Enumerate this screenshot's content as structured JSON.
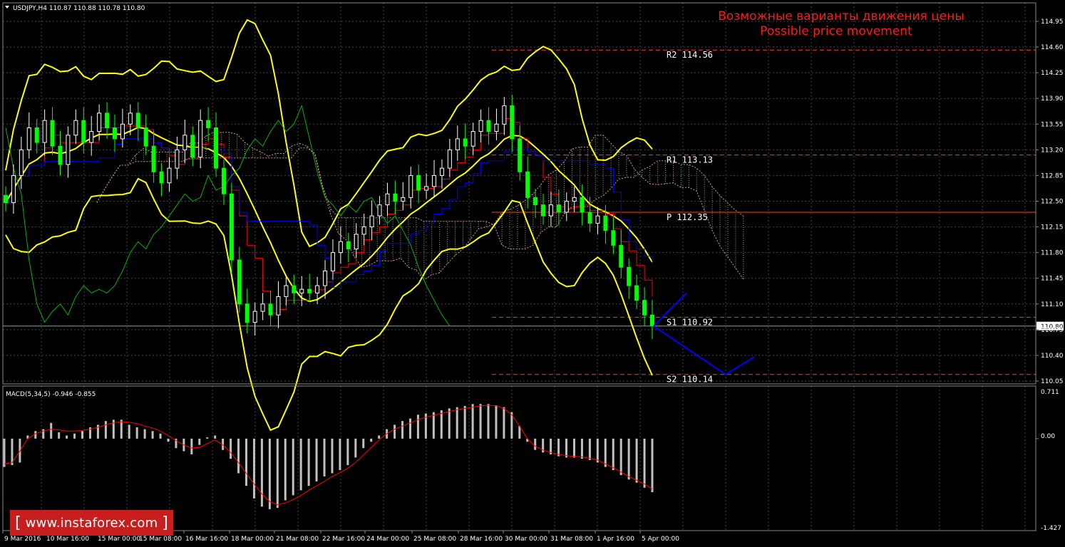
{
  "header": {
    "symbol_line": "USDJPY,H4  110.87 110.88 110.78 110.80"
  },
  "annotation": {
    "line1": "Возможные варианты движения цены",
    "line2": "Possible price movement"
  },
  "macd": {
    "label": "MACD(5,34,5) -0.946 -0.855",
    "axis": {
      "top": "0.711",
      "zero": "0.00",
      "bottom": "-1.427",
      "min": -1.427,
      "max": 0.711
    }
  },
  "watermark": {
    "bracket_left": "[",
    "text": "www.instaforex.com",
    "bracket_right": "]"
  },
  "colors": {
    "background": "#000000",
    "grid": "#3a4a3a",
    "bollinger": "#ffff00",
    "tenkan": "#ff0000",
    "kijun": "#0000ff",
    "chikou": "#00b400",
    "cloud": "#c8a080",
    "levels": "#ff3b1f",
    "forecast": "#0000ff",
    "candle_bull": "#ffffff",
    "candle_bear": "#00ff00",
    "signal": "#ff0000",
    "histogram": "#c0c0c0"
  },
  "chart_data": {
    "type": "line",
    "instrument": "USDJPY",
    "timeframe": "H4",
    "ohlc_current": {
      "open": 110.87,
      "high": 110.88,
      "low": 110.78,
      "close": 110.8
    },
    "ylim": [
      110.05,
      114.95
    ],
    "y_ticks": [
      "114.95",
      "114.60",
      "114.25",
      "113.90",
      "113.55",
      "113.20",
      "112.85",
      "112.50",
      "112.15",
      "111.80",
      "111.45",
      "111.10",
      "110.75",
      "110.40",
      "110.05"
    ],
    "current_price_label": "110.80",
    "x_ticks": [
      "9 Mar 2016",
      "10 Mar 16:00",
      "15 Mar 00:00",
      "15 Mar 08:00",
      "16 Mar 16:00",
      "18 Mar 00:00",
      "21 Mar 08:00",
      "22 Mar 16:00",
      "24 Mar 00:00",
      "25 Mar 08:00",
      "28 Mar 16:00",
      "30 Mar 00:00",
      "31 Mar 08:00",
      "1 Apr 16:00",
      "5 Apr 00:00"
    ],
    "pivot_levels": [
      {
        "name": "R2",
        "label": "R2 114.56",
        "value": 114.56
      },
      {
        "name": "R1",
        "label": "R1 113.13",
        "value": 113.13
      },
      {
        "name": "P",
        "label": "P 112.35",
        "value": 112.35
      },
      {
        "name": "S1",
        "label": "S1 110.92",
        "value": 110.92
      },
      {
        "name": "S2",
        "label": "S2 110.14",
        "value": 110.14
      }
    ],
    "close_series": [
      112.48,
      112.85,
      113.2,
      113.5,
      113.3,
      113.6,
      113.25,
      113.0,
      113.4,
      113.6,
      113.3,
      113.45,
      113.7,
      113.5,
      113.35,
      113.55,
      113.7,
      113.5,
      113.25,
      112.9,
      112.75,
      112.95,
      113.2,
      113.4,
      113.1,
      113.6,
      113.5,
      112.95,
      112.6,
      111.7,
      111.1,
      110.85,
      111.0,
      111.1,
      110.95,
      111.2,
      111.35,
      111.25,
      111.3,
      111.25,
      111.35,
      111.55,
      111.8,
      111.95,
      111.85,
      112.05,
      112.15,
      112.3,
      112.45,
      112.6,
      112.5,
      112.55,
      112.85,
      112.65,
      112.7,
      112.85,
      112.95,
      113.2,
      113.35,
      113.25,
      113.45,
      113.6,
      113.45,
      113.55,
      113.8,
      113.35,
      112.9,
      112.55,
      112.45,
      112.3,
      112.45,
      112.35,
      112.5,
      112.55,
      112.35,
      112.2,
      112.3,
      112.1,
      111.9,
      111.6,
      111.35,
      111.15,
      110.95,
      110.8
    ],
    "forecast_down": [
      [
        110.8,
        0
      ],
      [
        110.14,
        1
      ],
      [
        110.38,
        2
      ]
    ],
    "forecast_up": [
      [
        110.8,
        0
      ],
      [
        111.25,
        1
      ]
    ],
    "macd_histogram": [
      -0.45,
      -0.42,
      -0.38,
      0.05,
      0.12,
      0.15,
      0.25,
      0.1,
      0.05,
      0.08,
      0.12,
      0.18,
      0.22,
      0.28,
      0.3,
      0.3,
      0.22,
      0.18,
      0.15,
      0.12,
      0.08,
      -0.05,
      -0.15,
      -0.2,
      -0.25,
      -0.1,
      0.02,
      0.05,
      -0.18,
      -0.32,
      -0.55,
      -0.75,
      -0.95,
      -1.08,
      -1.12,
      -1.1,
      -0.98,
      -0.9,
      -0.82,
      -0.75,
      -0.68,
      -0.6,
      -0.55,
      -0.5,
      -0.42,
      -0.3,
      -0.15,
      -0.05,
      0.05,
      0.15,
      0.22,
      0.28,
      0.32,
      0.38,
      0.4,
      0.42,
      0.45,
      0.48,
      0.5,
      0.52,
      0.55,
      0.55,
      0.55,
      0.53,
      0.5,
      0.42,
      0.2,
      -0.05,
      -0.18,
      -0.22,
      -0.25,
      -0.28,
      -0.3,
      -0.3,
      -0.32,
      -0.34,
      -0.38,
      -0.45,
      -0.5,
      -0.58,
      -0.65,
      -0.7,
      -0.78,
      -0.85
    ],
    "macd_signal": [
      -0.4,
      -0.38,
      -0.2,
      0.0,
      0.08,
      0.12,
      0.15,
      0.14,
      0.12,
      0.12,
      0.13,
      0.15,
      0.18,
      0.22,
      0.25,
      0.27,
      0.26,
      0.24,
      0.2,
      0.17,
      0.12,
      0.05,
      -0.03,
      -0.1,
      -0.15,
      -0.14,
      -0.08,
      -0.02,
      -0.1,
      -0.22,
      -0.38,
      -0.55,
      -0.72,
      -0.88,
      -1.0,
      -1.05,
      -1.02,
      -0.97,
      -0.9,
      -0.82,
      -0.75,
      -0.68,
      -0.6,
      -0.54,
      -0.47,
      -0.38,
      -0.26,
      -0.14,
      -0.02,
      0.08,
      0.15,
      0.2,
      0.25,
      0.3,
      0.34,
      0.37,
      0.4,
      0.43,
      0.46,
      0.48,
      0.5,
      0.52,
      0.53,
      0.52,
      0.48,
      0.38,
      0.2,
      0.0,
      -0.12,
      -0.18,
      -0.22,
      -0.25,
      -0.27,
      -0.28,
      -0.29,
      -0.31,
      -0.34,
      -0.4,
      -0.46,
      -0.53,
      -0.6,
      -0.66,
      -0.72,
      -0.8
    ]
  }
}
